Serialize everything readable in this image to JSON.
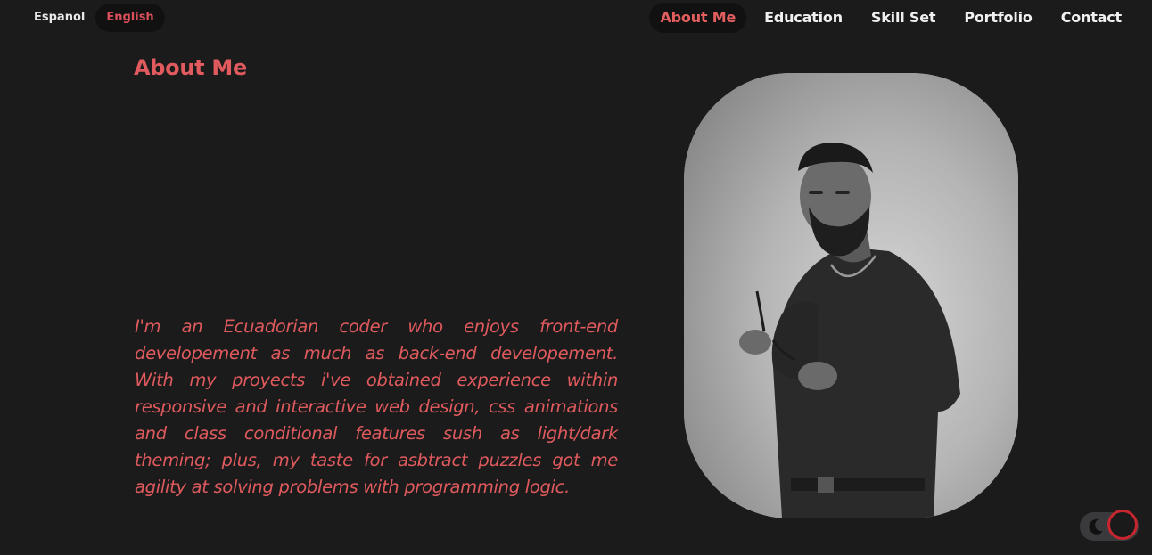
{
  "language_switch": {
    "items": [
      {
        "label": "Español",
        "active": false
      },
      {
        "label": "English",
        "active": true
      }
    ]
  },
  "nav": {
    "items": [
      {
        "label": "About Me",
        "active": true
      },
      {
        "label": "Education",
        "active": false
      },
      {
        "label": "Skill Set",
        "active": false
      },
      {
        "label": "Portfolio",
        "active": false
      },
      {
        "label": "Contact",
        "active": false
      }
    ]
  },
  "about": {
    "title": "About Me",
    "bio": "I'm an Ecuadorian coder who enjoys front-end developement as much as back-end developement. With my proyects i've obtained experience within responsive and interactive web design, css animations and class conditional features sush as light/dark theming; plus, my taste for asbtract puzzles got me agility at solving problems with programming logic."
  },
  "portrait": {
    "icon": "profile-photo"
  },
  "theme_toggle": {
    "mode": "dark",
    "icon": "moon-icon"
  },
  "colors": {
    "background": "#1b1b1c",
    "accent": "#e05a5e",
    "toggle_ring": "#c8262e"
  }
}
